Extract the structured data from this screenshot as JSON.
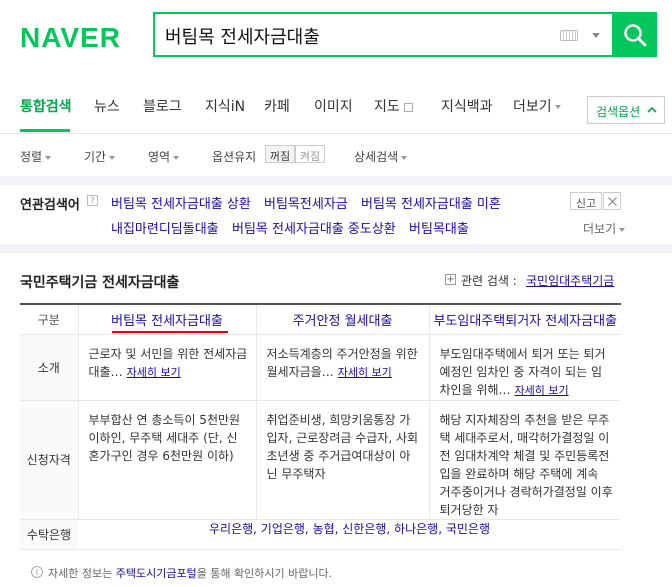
{
  "header": {
    "logo": "NAVER",
    "query": "버팀목 전세자금대출"
  },
  "tabs": [
    {
      "label": "통합검색"
    },
    {
      "label": "뉴스"
    },
    {
      "label": "블로그"
    },
    {
      "label": "지식iN"
    },
    {
      "label": "카페"
    },
    {
      "label": "이미지"
    },
    {
      "label": "지도"
    },
    {
      "label": "지식백과"
    },
    {
      "label": "더보기"
    }
  ],
  "search_options_label": "검색옵션",
  "filters": {
    "sort": "정렬",
    "period": "기간",
    "area": "영역",
    "option_keep": "옵션유지",
    "toggle_off": "꺼짐",
    "toggle_on": "켜짐",
    "detail_search": "상세검색"
  },
  "related": {
    "title": "연관검색어",
    "links": [
      "버팀목 전세자금대출 상환",
      "버팀목전세자금",
      "버팀목 전세자금대출 미혼",
      "내집마련디딤돌대출",
      "버팀목 전세자금대출 중도상환",
      "버팀목대출"
    ],
    "report": "신고",
    "more": "더보기"
  },
  "section": {
    "title": "국민주택기금 전세자금대출",
    "related_label": "관련 검색 :",
    "related_link": "국민임대주택기금"
  },
  "table": {
    "row_header_label": "구분",
    "columns": [
      "버팀목 전세자금대출",
      "주거안정 월세대출",
      "부도임대주택퇴거자 전세자금대출"
    ],
    "rows": [
      {
        "label": "소개",
        "cells": [
          "근로자 및 서민을 위한 전세자금 대출…",
          "저소득계층의 주거안정을 위한 월세자금을…",
          "부도임대주택에서 퇴거 또는 퇴거 예정인 임차인 중 자격이 되는 임차인을 위해…"
        ],
        "detail": "자세히 보기"
      },
      {
        "label": "신청자격",
        "cells": [
          "부부합산 연 총소득이 5천만원 이하인, 무주택 세대주 (단, 신혼가구인 경우 6천만원 이하)",
          "취업준비생, 희망키움통장 가입자, 근로장려금 수급자, 사회초년생 중 주거급여대상이 아닌 무주택자",
          "해당 지자체장의 추천을 받은 무주택 세대주로서, 매각허가결정일 이전 임대차계약 체결 및 주민등록전입을 완료하며 해당 주택에 계속 거주중이거나 경락허가결정일 이후 퇴거당한 자"
        ]
      },
      {
        "label": "수탁은행",
        "banks": "우리은행, 기업은행, 농협, 신한은행, 하나은행, 국민은행"
      }
    ]
  },
  "notice": {
    "prefix": "자세한 정보는",
    "link": "주택도시기금포털",
    "suffix": "을 통해 확인하시기 바랍니다."
  }
}
